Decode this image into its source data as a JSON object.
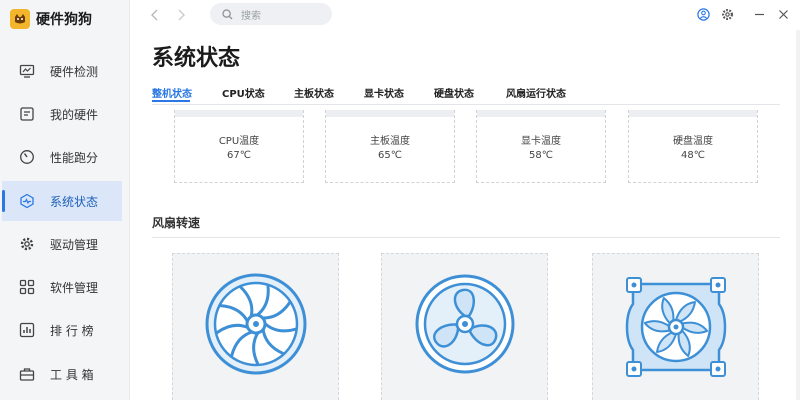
{
  "app": {
    "name": "硬件狗狗"
  },
  "sidebar": {
    "items": [
      {
        "label": "硬件检测",
        "icon": "monitor-icon"
      },
      {
        "label": "我的硬件",
        "icon": "hardware-icon"
      },
      {
        "label": "性能跑分",
        "icon": "speedometer-icon"
      },
      {
        "label": "系统状态",
        "icon": "pulse-icon",
        "active": true
      },
      {
        "label": "驱动管理",
        "icon": "gear-icon"
      },
      {
        "label": "软件管理",
        "icon": "apps-icon"
      },
      {
        "label": "排 行 榜",
        "icon": "ranking-icon"
      },
      {
        "label": "工 具 箱",
        "icon": "toolbox-icon"
      }
    ]
  },
  "search": {
    "placeholder": "搜索"
  },
  "page": {
    "title": "系统状态"
  },
  "tabs": [
    {
      "label": "整机状态",
      "active": true
    },
    {
      "label": "CPU状态"
    },
    {
      "label": "主板状态"
    },
    {
      "label": "显卡状态"
    },
    {
      "label": "硬盘状态"
    },
    {
      "label": "风扇运行状态"
    }
  ],
  "temps": [
    {
      "label": "CPU温度",
      "value": "67℃"
    },
    {
      "label": "主板温度",
      "value": "65℃"
    },
    {
      "label": "显卡温度",
      "value": "58℃"
    },
    {
      "label": "硬盘温度",
      "value": "48℃"
    }
  ],
  "fans": {
    "title": "风扇转速",
    "items": [
      {
        "icon": "cpu-fan-icon"
      },
      {
        "icon": "propeller-fan-icon"
      },
      {
        "icon": "case-fan-icon"
      }
    ]
  },
  "colors": {
    "accent": "#2b78e4",
    "fan_stroke": "#3d8fd6",
    "fan_fill": "#cfe5f7"
  }
}
